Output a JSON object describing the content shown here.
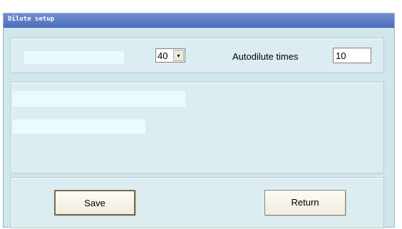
{
  "window": {
    "title": "Dilute setup"
  },
  "dilute_select": {
    "value": "40",
    "arrow": "▾"
  },
  "autodilute": {
    "label": "Autodilute times",
    "value": "10"
  },
  "buttons": {
    "save": "Save",
    "return": "Return"
  }
}
